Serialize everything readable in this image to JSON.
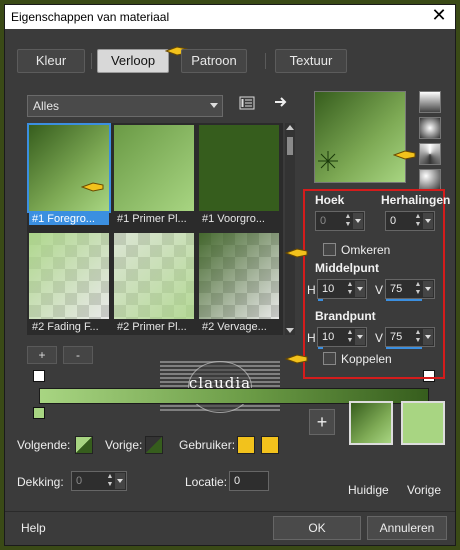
{
  "window": {
    "title": "Eigenschappen van materiaal",
    "close": "✕"
  },
  "tabs": [
    {
      "label": "Kleur"
    },
    {
      "label": "Verloop"
    },
    {
      "label": "Patroon"
    },
    {
      "label": "Textuur"
    }
  ],
  "gallery": {
    "filter": "Alles",
    "items": [
      {
        "label": "#1 Foregro..."
      },
      {
        "label": "#1 Primer Pl..."
      },
      {
        "label": "#1 Voorgro..."
      },
      {
        "label": "#2 Fading F..."
      },
      {
        "label": "#2 Primer Pl..."
      },
      {
        "label": "#2 Vervage..."
      }
    ],
    "add": "+",
    "remove": "-"
  },
  "params": {
    "hoek_label": "Hoek",
    "hoek_value": "0",
    "herhalingen_label": "Herhalingen",
    "herhalingen_value": "0",
    "omkeren_label": "Omkeren",
    "middelpunt_label": "Middelpunt",
    "middelpunt_h_label": "H",
    "middelpunt_h": "10",
    "middelpunt_v_label": "V",
    "middelpunt_v": "75",
    "brandpunt_label": "Brandpunt",
    "brandpunt_h_label": "H",
    "brandpunt_h": "10",
    "brandpunt_v_label": "V",
    "brandpunt_v": "75",
    "koppelen_label": "Koppelen"
  },
  "bottom": {
    "volgende_label": "Volgende:",
    "vorige_label": "Vorige:",
    "gebruiker_label": "Gebruiker:",
    "dekking_label": "Dekking:",
    "dekking_value": "0",
    "locatie_label": "Locatie:",
    "locatie_value": "0",
    "add": "+",
    "huidige_label": "Huidige",
    "vorige_swatch_label": "Vorige",
    "help": "Help",
    "ok": "OK",
    "cancel": "Annuleren"
  },
  "watermark": {
    "text": "claudia"
  },
  "colors": {
    "light_green": "#a8d582",
    "dark_green": "#365d1d",
    "accent_blue": "#3b8fe0",
    "highlight_red": "#d41c1c",
    "user_yellow": "#f2c21c"
  }
}
